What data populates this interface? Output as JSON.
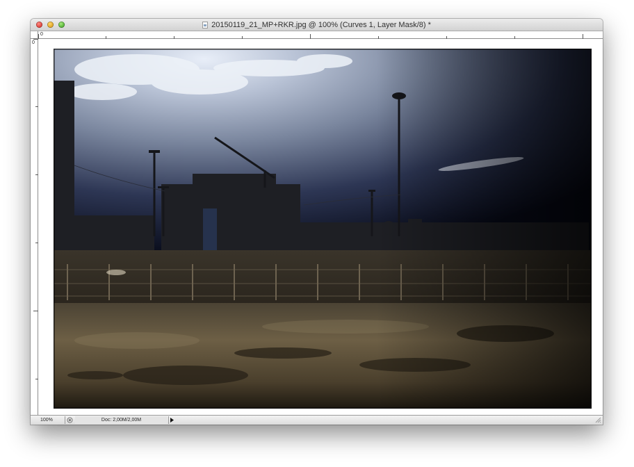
{
  "window": {
    "title": "20150119_21_MP+RKR.jpg @ 100% (Curves 1, Layer Mask/8) *"
  },
  "rulers": {
    "top_origin": "0",
    "left_origin": "0"
  },
  "statusbar": {
    "zoom": "100%",
    "doc_info": "Doc: 2,00M/2,00M"
  },
  "icons": {
    "close": "close-button-red",
    "minimize": "minimize-button-yellow",
    "maximize": "zoom-button-green",
    "document": "document-icon",
    "status": "status-info-icon",
    "arrow": "triangle-right-icon",
    "grip": "resize-grip-icon"
  },
  "colors": {
    "sky_dark": "#0b1024",
    "sky_light": "#aeb7c8",
    "ground": "#6b5d44",
    "window_chrome": "#ececec"
  }
}
